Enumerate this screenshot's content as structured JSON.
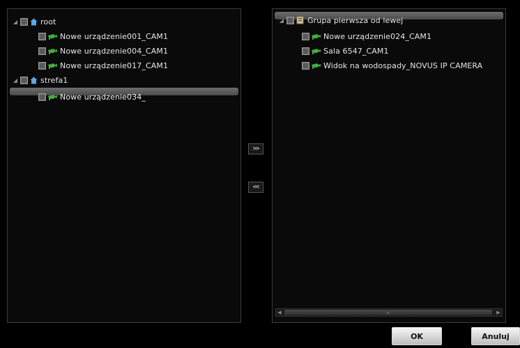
{
  "left_tree": {
    "nodes": [
      {
        "label": "root",
        "type": "root"
      },
      {
        "label": "Nowe urządzenie001_CAM1",
        "type": "camera"
      },
      {
        "label": "Nowe urządzenie004_CAM1",
        "type": "camera"
      },
      {
        "label": "Nowe urządzenie017_CAM1",
        "type": "camera"
      },
      {
        "label": "strefa1",
        "type": "root"
      },
      {
        "label": "Nowe urządzenie034_",
        "type": "camera",
        "selected": true
      }
    ]
  },
  "transfer": {
    "add_label": ">>",
    "remove_label": "<<"
  },
  "right_tree": {
    "nodes": [
      {
        "label": "Grupa pierwsza od lewej",
        "type": "group",
        "selected": true
      },
      {
        "label": "Nowe urządzenie024_CAM1",
        "type": "camera"
      },
      {
        "label": "Sala 6547_CAM1",
        "type": "camera"
      },
      {
        "label": "Widok na wodospady_NOVUS IP CAMERA",
        "type": "camera"
      }
    ]
  },
  "buttons": {
    "ok_label": "OK",
    "cancel_label": "Anuluj"
  },
  "icons": {
    "root": "home-icon",
    "group": "folder-icon",
    "camera": "camera-icon"
  },
  "colors": {
    "background": "#000000",
    "camera_icon": "#3fae3f",
    "home_icon": "#5aa8e6"
  }
}
